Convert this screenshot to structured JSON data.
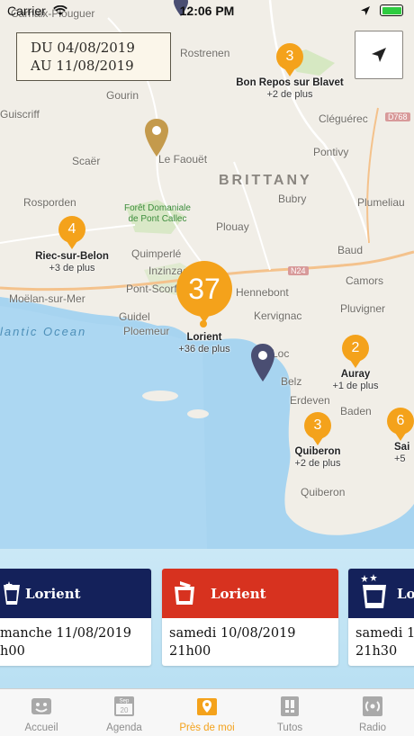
{
  "status_bar": {
    "carrier": "Carrier",
    "time": "12:06 PM"
  },
  "date_range": {
    "from": "DU 04/08/2019",
    "to": "AU 11/08/2019"
  },
  "map": {
    "region": "BRITTANY",
    "ocean": "lantic Ocean",
    "forest": "Forêt Domaniale\nde Pont Callec",
    "places": [
      "Carhaix-Plouguer",
      "Rostrenen",
      "Gourin",
      "Guiscriff",
      "Scaër",
      "Le Faouët",
      "Cléguérec",
      "Pontivy",
      "Rosporden",
      "Bubry",
      "Baud",
      "Plouay",
      "Quimperlé",
      "Inzinzac",
      "Pont-Scorff",
      "Guidel",
      "Moëlan-sur-Mer",
      "Hennebont",
      "Kervignac",
      "Ploemeur",
      "Belz",
      "Erdeven",
      "Camors",
      "Pluvigner",
      "Baden",
      "Quiberon",
      "Plumeliau",
      "Loc"
    ],
    "roads": [
      "D768",
      "N24"
    ]
  },
  "clusters": [
    {
      "count": "3",
      "name": "Bon Repos sur Blavet",
      "more": "+2 de plus"
    },
    {
      "count": "4",
      "name": "Riec-sur-Belon",
      "more": "+3 de plus"
    },
    {
      "count": "37",
      "name": "Lorient",
      "more": "+36 de plus"
    },
    {
      "count": "2",
      "name": "Auray",
      "more": "+1 de plus"
    },
    {
      "count": "3",
      "name": "Quiberon",
      "more": "+2 de plus"
    },
    {
      "count": "6",
      "name": "Sai",
      "more": "+5"
    }
  ],
  "cards": [
    {
      "city": "Lorient",
      "date": "manche 11/08/2019",
      "time": "h00"
    },
    {
      "city": "Lorient",
      "date": "samedi 10/08/2019",
      "time": "21h00"
    },
    {
      "city": "Lor",
      "date": "samedi 1",
      "time": "21h30"
    }
  ],
  "tabs": [
    {
      "label": "Accueil",
      "icon": "home-icon"
    },
    {
      "label": "Agenda",
      "icon": "calendar-icon",
      "icon_text": "Sep",
      "icon_day": "20"
    },
    {
      "label": "Près de moi",
      "icon": "map-pin-icon",
      "active": true
    },
    {
      "label": "Tutos",
      "icon": "tutos-icon"
    },
    {
      "label": "Radio",
      "icon": "radio-icon"
    }
  ],
  "colors": {
    "accent": "#f4a21b",
    "navy": "#14215a",
    "red": "#d7321f"
  }
}
